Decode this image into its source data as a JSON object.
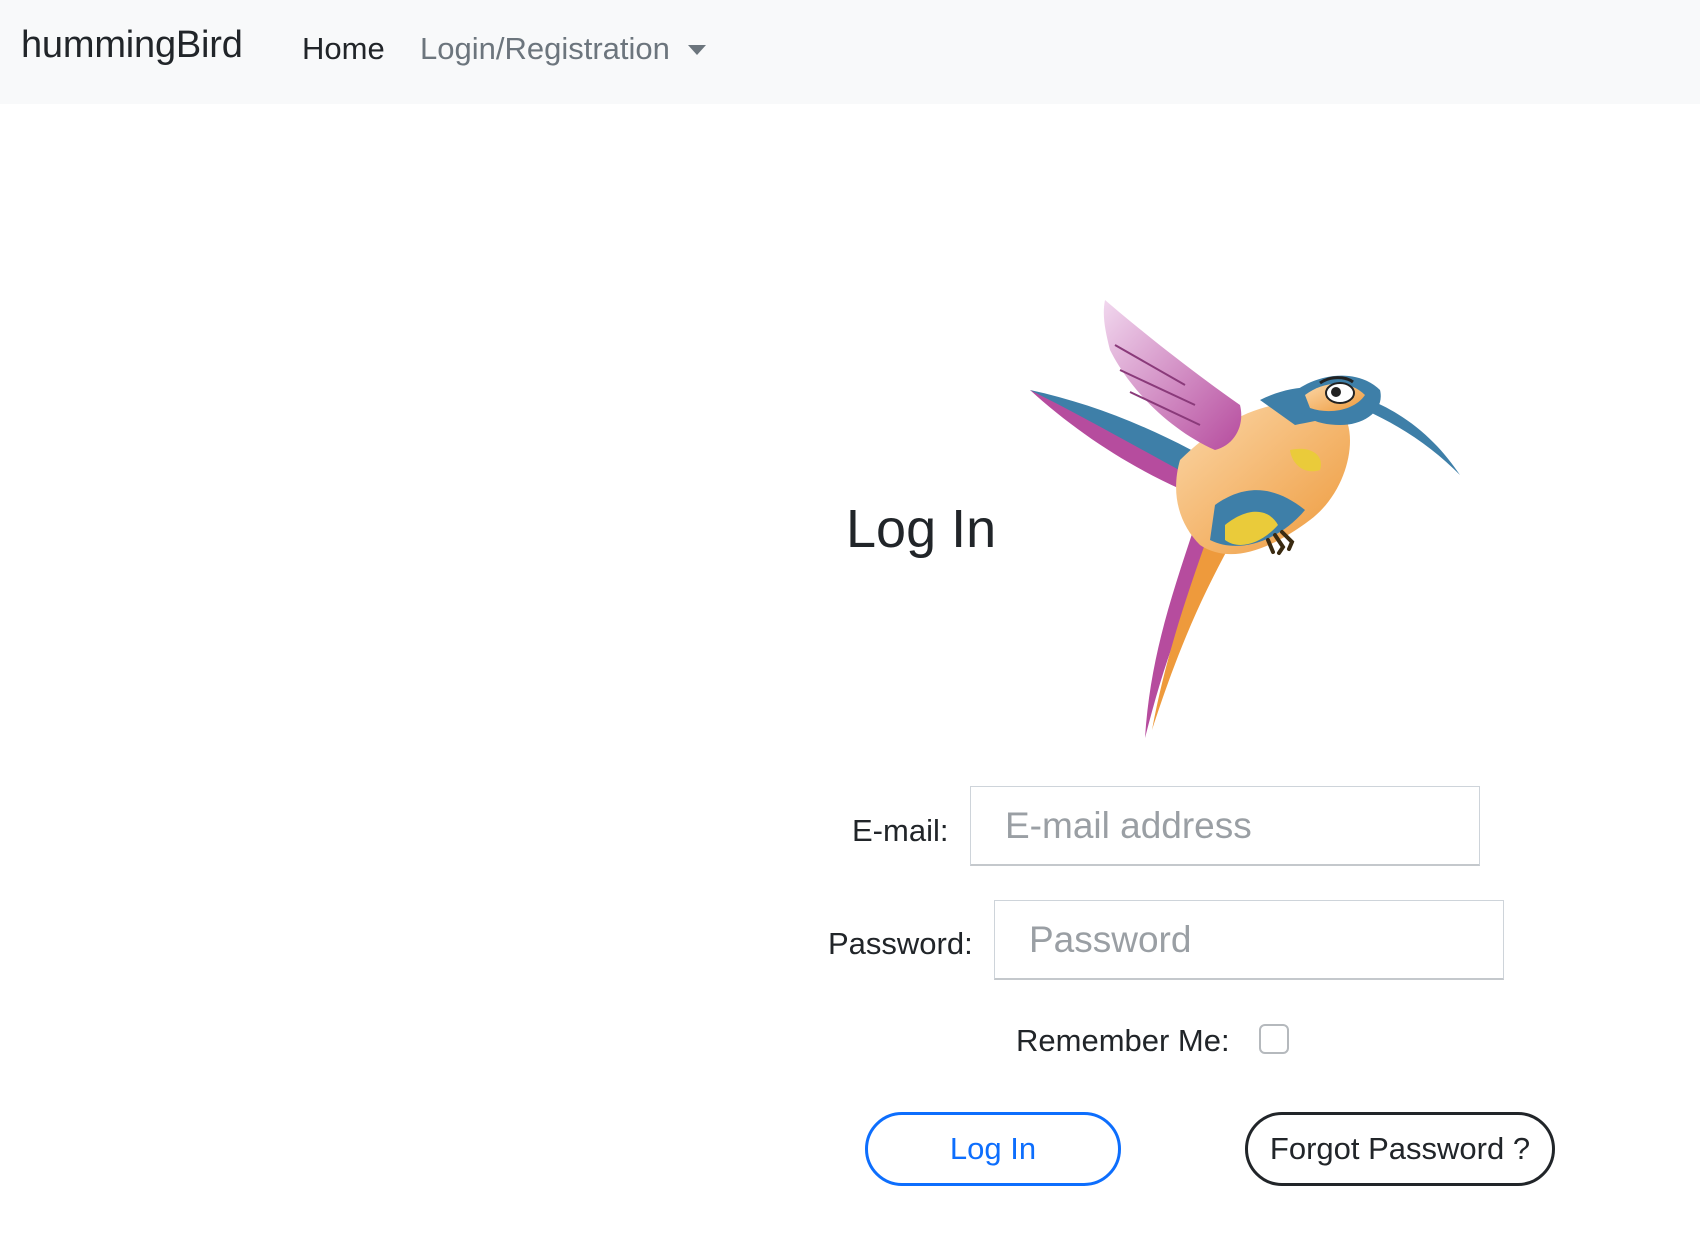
{
  "navbar": {
    "brand": "hummingBird",
    "home": "Home",
    "dropdown": "Login/Registration"
  },
  "page": {
    "title": "Log In"
  },
  "form": {
    "email_label": "E-mail:",
    "email_placeholder": "E-mail address",
    "password_label": "Password:",
    "password_placeholder": "Password",
    "remember_label": "Remember Me:",
    "remember_checked": false,
    "login_button": "Log In",
    "forgot_button": "Forgot Password ?"
  },
  "colors": {
    "navbar_bg": "#f8f9fa",
    "primary": "#0d6efd",
    "text": "#212529",
    "muted": "#6c757d"
  }
}
